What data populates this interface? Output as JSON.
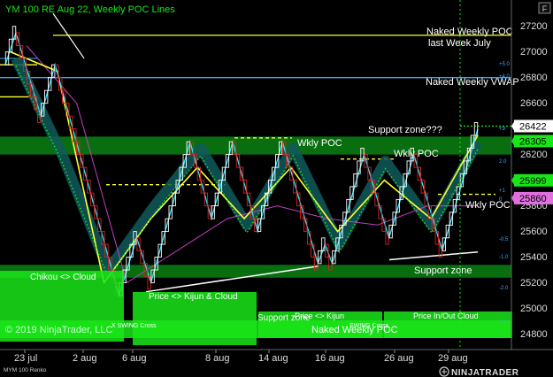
{
  "window": {
    "title": "YM 100 RE Aug 22, Weekly POC Lines",
    "button_label": "F"
  },
  "instrument_label": "MYM 100 Renko",
  "copyright": "© 2019 NinjaTrader, LLC",
  "brand": "NINJATRADER",
  "colors": {
    "background": "#000000",
    "up_bar": "#ffffff",
    "down_bar": "#e02020",
    "zone_green": "#0a8a14",
    "bright_green": "#19e619",
    "yellow": "#ffff33",
    "cyan": "#33e6ff",
    "magenta": "#c040c0"
  },
  "chart_data": {
    "type": "renko",
    "title": "YM 100 RE Aug 22, Weekly POC Lines",
    "ylim": [
      24700,
      27350
    ],
    "y_ticks": [
      24800,
      25000,
      25200,
      25400,
      25600,
      25800,
      26000,
      26200,
      26400,
      26600,
      26800,
      27000,
      27200
    ],
    "x_labels": [
      "23 jul",
      "2 aug",
      "6 aug",
      "8 aug",
      "14 aug",
      "16 aug",
      "26 aug",
      "29 aug"
    ],
    "brick_size": 100,
    "renko_path": [
      26900,
      27150,
      26500,
      26900,
      25100,
      25550,
      25200,
      26300,
      25700,
      26300,
      25600,
      26300,
      25350,
      25500,
      25350,
      26200,
      25550,
      26200,
      25450,
      26400
    ],
    "cyan_band": [
      26950,
      26200,
      25300,
      25800,
      26250,
      25650,
      26250,
      25500,
      26150,
      25650,
      26300
    ],
    "yellow_line": [
      27000,
      26850,
      25200,
      25700,
      26100,
      25700,
      26100,
      25600,
      26000,
      25700,
      26350
    ],
    "magenta_line": [
      27050,
      26600,
      25200,
      25450,
      25700,
      25800,
      25700,
      25650,
      25800,
      25800
    ],
    "price_badges": [
      {
        "value": "26422",
        "bg": "#ffffff",
        "fg": "#000000"
      },
      {
        "value": "26305",
        "bg": "#19e619",
        "fg": "#000000"
      },
      {
        "value": "25999",
        "bg": "#19e619",
        "fg": "#000000"
      },
      {
        "value": "25860",
        "bg": "#e070e0",
        "fg": "#000000"
      }
    ],
    "horizontal_lines": [
      {
        "price": 27130,
        "color": "#ffff33",
        "style": "solid"
      },
      {
        "price": 26800,
        "color": "#33aaff",
        "style": "solid"
      },
      {
        "price": 26422,
        "color": "#19e619",
        "style": "dotted"
      },
      {
        "price": 26900,
        "color": "#ffff33",
        "style": "solid"
      },
      {
        "price": 26650,
        "color": "#ffff33",
        "style": "solid"
      }
    ],
    "zones": [
      {
        "price_top": 26340,
        "price_bottom": 26200,
        "color": "#0a7a12"
      },
      {
        "price_top": 25340,
        "price_bottom": 25240,
        "color": "#0a7a12"
      }
    ],
    "volume_ticks": [
      "+3",
      "+5.0",
      "+4.0",
      "+3",
      "2.0",
      "+1",
      "0",
      "-0.5",
      "-1.0",
      "-2.0",
      "-3.0"
    ],
    "annotations": [
      {
        "text": "Naked Weekly POC"
      },
      {
        "text": "last Week July"
      },
      {
        "text": "Naked Weekly VWAP"
      },
      {
        "text": "Support zone???"
      },
      {
        "text": "Wkly POC"
      },
      {
        "text": "Wkly POC"
      },
      {
        "text": "Wkly POC"
      },
      {
        "text": "Support zone"
      },
      {
        "text": "Chikou <> Cloud"
      },
      {
        "text": "Price <> Kijun & Cloud"
      },
      {
        "text": "X SWING Cross"
      },
      {
        "text": "Support zone"
      },
      {
        "text": "Price <> Kijun"
      },
      {
        "text": "SWING Cross"
      },
      {
        "text": "Naked Weekly POC"
      },
      {
        "text": "Price In/Out Cloud"
      }
    ]
  }
}
